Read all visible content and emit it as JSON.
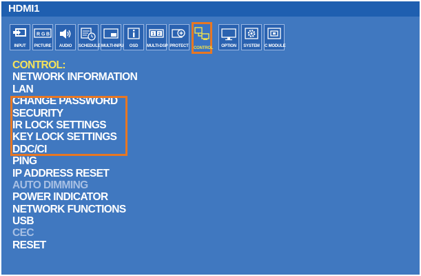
{
  "header": {
    "title": "HDMI1"
  },
  "tabs": [
    {
      "label": "INPUT",
      "icon": "input-icon"
    },
    {
      "label": "PICTURE",
      "icon": "picture-rgb-icon"
    },
    {
      "label": "AUDIO",
      "icon": "speaker-icon"
    },
    {
      "label": "SCHEDULE",
      "icon": "schedule-clock-icon"
    },
    {
      "label": "MULTI-INPUT",
      "icon": "multi-input-icon"
    },
    {
      "label": "OSD",
      "icon": "info-icon"
    },
    {
      "label": "MULTI-DSP",
      "icon": "multi-display-icon"
    },
    {
      "label": "PROTECT",
      "icon": "shield-plus-icon"
    },
    {
      "label": "CONTROL",
      "icon": "control-network-icon",
      "selected": true
    },
    {
      "label": "OPTION",
      "icon": "option-monitor-icon"
    },
    {
      "label": "SYSTEM",
      "icon": "gear-icon"
    },
    {
      "label": "C MODULE",
      "icon": "compute-module-icon"
    }
  ],
  "menu": {
    "heading": "CONTROL:",
    "items": [
      {
        "label": "NETWORK INFORMATION",
        "enabled": true
      },
      {
        "label": "LAN",
        "enabled": true
      },
      {
        "label": "CHANGE PASSWORD",
        "enabled": true
      },
      {
        "label": "SECURITY",
        "enabled": true
      },
      {
        "label": "IR LOCK SETTINGS",
        "enabled": true
      },
      {
        "label": "KEY LOCK SETTINGS",
        "enabled": true
      },
      {
        "label": "DDC/CI",
        "enabled": true
      },
      {
        "label": "PING",
        "enabled": true
      },
      {
        "label": "IP ADDRESS RESET",
        "enabled": true
      },
      {
        "label": "AUTO DIMMING",
        "enabled": false
      },
      {
        "label": "POWER INDICATOR",
        "enabled": true
      },
      {
        "label": "NETWORK FUNCTIONS",
        "enabled": true
      },
      {
        "label": "USB",
        "enabled": true
      },
      {
        "label": "CEC",
        "enabled": false
      },
      {
        "label": "RESET",
        "enabled": true
      }
    ]
  },
  "colors": {
    "background": "#4078c0",
    "title_bar": "#1f5fb0",
    "heading_text": "#f5e35a",
    "disabled_text": "#a8c0e4",
    "highlight": "#e87722"
  }
}
